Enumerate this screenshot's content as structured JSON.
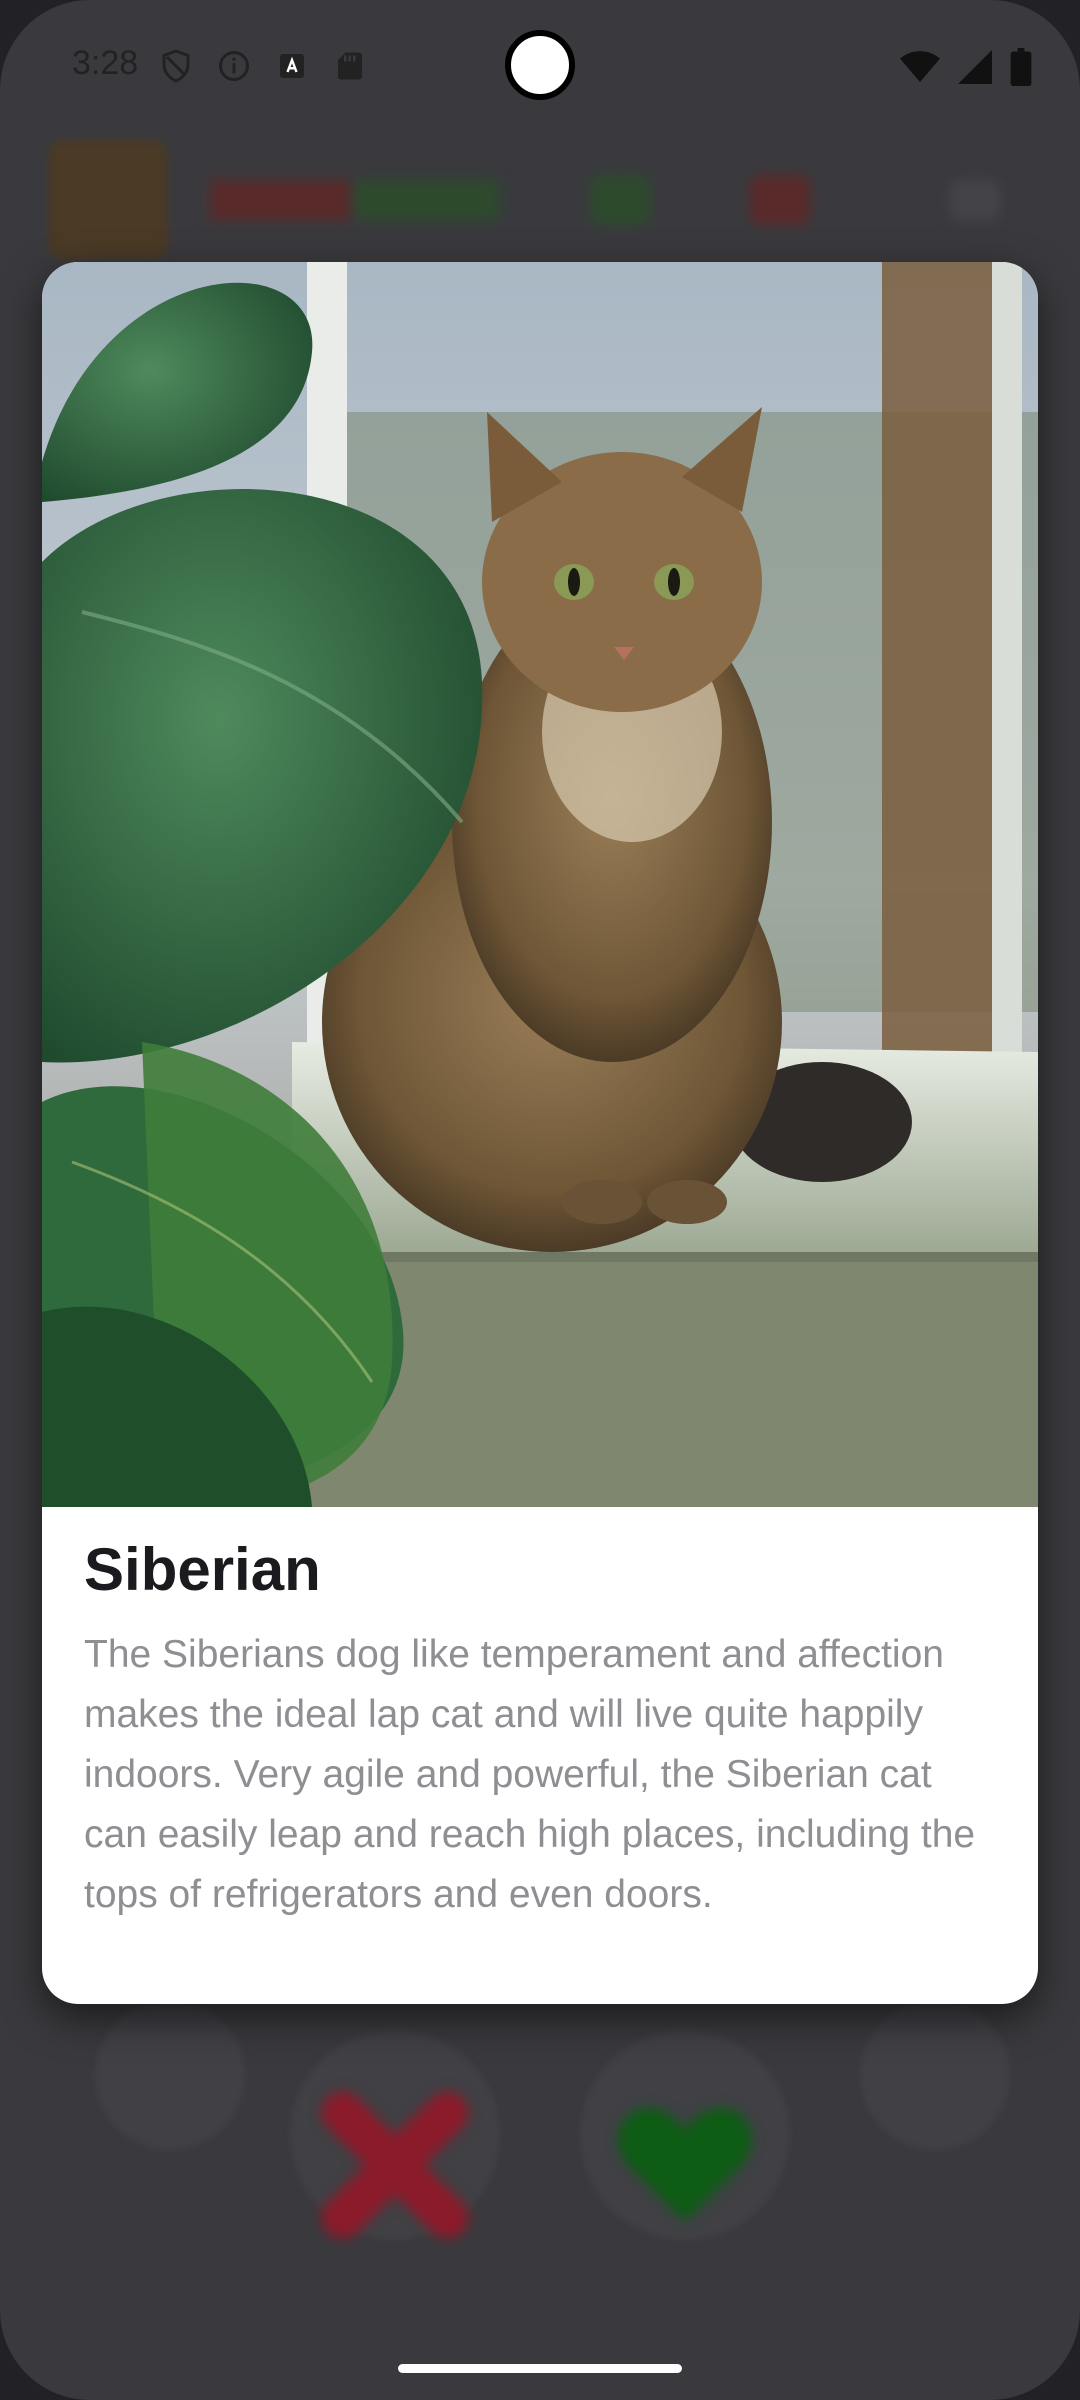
{
  "status_bar": {
    "time": "3:28",
    "left_icons": [
      "shield-icon",
      "info-icon",
      "font-icon",
      "sd-card-icon"
    ],
    "right_icons": [
      "wifi-icon",
      "signal-icon",
      "battery-icon"
    ]
  },
  "card": {
    "title": "Siberian",
    "description": "The Siberians dog like temperament and affection makes the ideal lap cat and will live quite happily indoors. Very agile and powerful, the Siberian cat can easily leap and reach high places, including the tops of refrigerators and even doors.",
    "image_subject": "cat-photo"
  },
  "background_app": {
    "actions": [
      "refresh-icon",
      "dislike-x-icon",
      "like-heart-icon",
      "star-icon"
    ]
  },
  "colors": {
    "scrim": "#3a3a3e",
    "card_bg": "#ffffff",
    "title": "#1b1b1f",
    "description": "#8e8e93",
    "dislike": "#8b1a2a",
    "like": "#0d5c14"
  }
}
